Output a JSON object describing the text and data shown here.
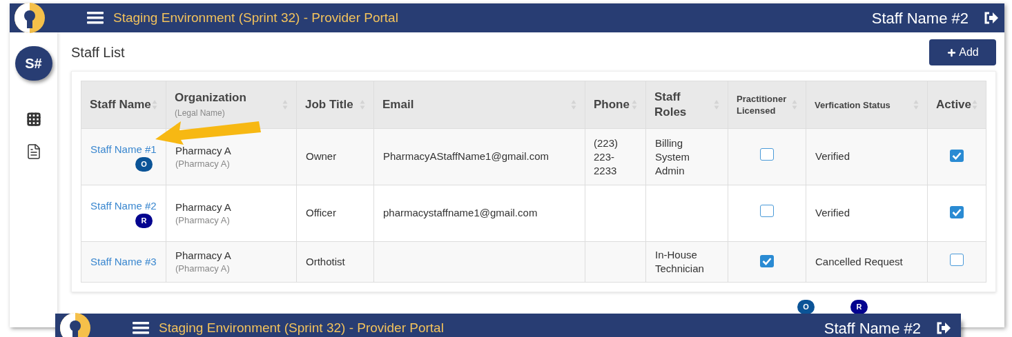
{
  "header": {
    "title": "Staging Environment (Sprint 32) - Provider Portal",
    "user": "Staff Name #2"
  },
  "avatar": "S#",
  "page_title": "Staff List",
  "add_button": "Add",
  "columns": [
    {
      "label": "Staff Name",
      "kind": "large"
    },
    {
      "label": "Organization",
      "sublabel": "(Legal Name)",
      "kind": "large"
    },
    {
      "label": "Job Title",
      "kind": "large"
    },
    {
      "label": "Email",
      "kind": "large"
    },
    {
      "label": "Phone",
      "kind": "large"
    },
    {
      "label": "Staff Roles",
      "kind": "large"
    },
    {
      "label": "Practitioner Licensed",
      "kind": "small"
    },
    {
      "label": "Verfication Status",
      "kind": "small"
    },
    {
      "label": "Active",
      "kind": "large"
    }
  ],
  "rows": [
    {
      "name": "Staff Name #1",
      "badge": {
        "letter": "O",
        "color": "#0b5497"
      },
      "organization": "Pharmacy A",
      "legal_name": "(Pharmacy A)",
      "job_title": "Owner",
      "email": "PharmacyAStaffName1@gmail.com",
      "phone": "(223) 223-2233",
      "roles": "Billing System Admin",
      "licensed": false,
      "status": "Verified",
      "active": true
    },
    {
      "name": "Staff Name #2",
      "badge": {
        "letter": "R",
        "color": "#04048f"
      },
      "organization": "Pharmacy A",
      "legal_name": "(Pharmacy A)",
      "job_title": "Officer",
      "email": "pharmacystaffname1@gmail.com",
      "licensed": false,
      "status": "Verified",
      "active": true
    },
    {
      "name": "Staff Name #3",
      "organization": "Pharmacy A",
      "legal_name": "(Pharmacy A)",
      "job_title": "Orthotist",
      "roles": "In-House Technician",
      "licensed": true,
      "status": "Cancelled Request",
      "active": false
    }
  ],
  "legend_badges": [
    {
      "letter": "O",
      "color": "#0b5497"
    },
    {
      "letter": "R",
      "color": "#04048f"
    }
  ],
  "overlay_header": {
    "title": "Staging Environment (Sprint 32) - Provider Portal",
    "user": "Staff Name #2"
  }
}
